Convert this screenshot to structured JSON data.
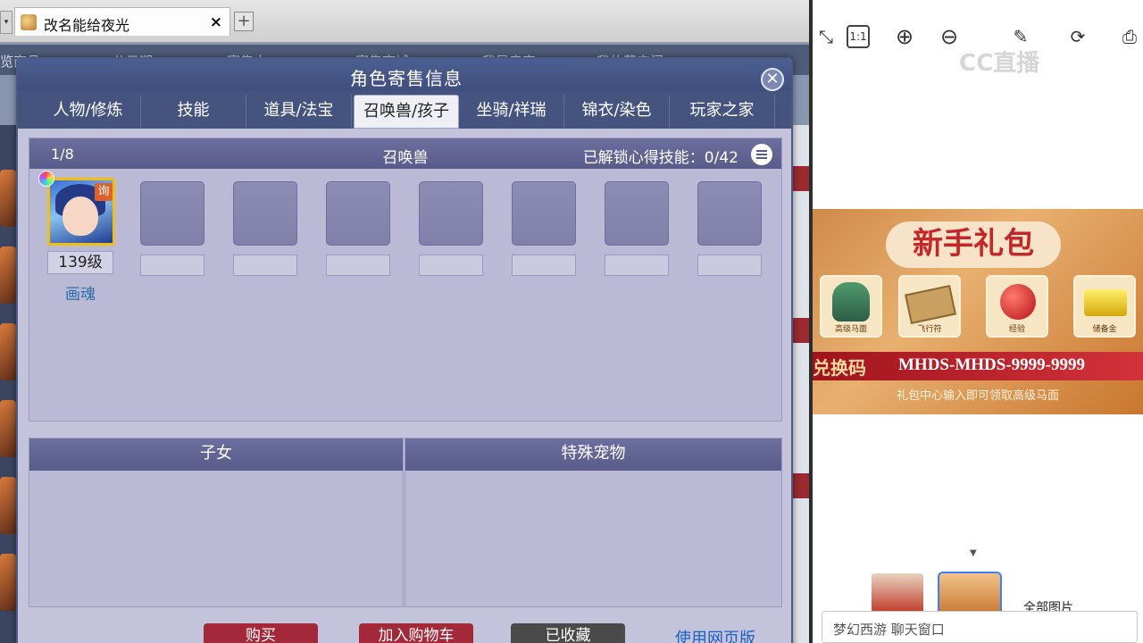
{
  "browser": {
    "tab_title": "改名能给夜光",
    "tab_close": "×",
    "new_tab": "+",
    "nav_items": [
      "览商品",
      "公示期",
      "寄售中",
      "寄售商城",
      "我是卖家",
      "我的藏宝阁"
    ]
  },
  "dialog": {
    "title": "角色寄售信息",
    "close": "✕",
    "tabs": [
      "人物/修炼",
      "技能",
      "道具/法宝",
      "召唤兽/孩子",
      "坐骑/祥瑞",
      "锦衣/染色",
      "玩家之家"
    ],
    "active_tab": "召唤兽/孩子"
  },
  "summon": {
    "count": "1/8",
    "title": "召唤兽",
    "skill_label": "已解锁心得技能：0/42",
    "pet": {
      "level": "139级",
      "name": "画魂",
      "badge": "询"
    },
    "empty_slots": 7
  },
  "children": {
    "title": "子女"
  },
  "special_pets": {
    "title": "特殊宠物"
  },
  "actions": {
    "buy": "购买",
    "add_cart": "加入购物车",
    "favorited": "已收藏",
    "web_version": "使用网页版"
  },
  "right_panel": {
    "watermark": "CC直播",
    "banner": {
      "title": "新手礼包",
      "gifts": [
        "高级马面",
        "飞行符",
        "经验",
        "储备金"
      ],
      "code_label": "兑换码",
      "code": "MHDS-MHDS-9999-9999",
      "note": "礼包中心输入即可领取高级马面"
    },
    "all_images": "全部图片",
    "chat_placeholder": "梦幻西游 聊天窗口"
  },
  "colors": {
    "dialog_header": "#44547f",
    "panel_bg": "#babad6",
    "buy_button": "#a3283a",
    "cart_button": "#a3283a",
    "favorited_button": "#4a4a4a",
    "link": "#1d5fbf",
    "pet_frame": "#f0c010"
  }
}
